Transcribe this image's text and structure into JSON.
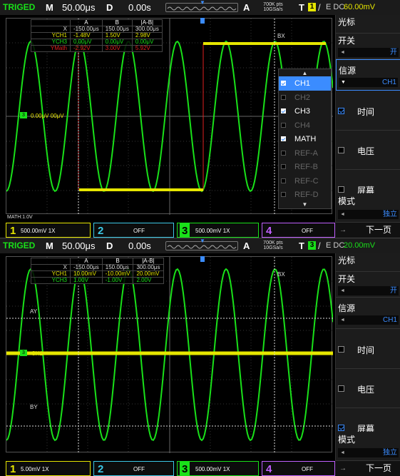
{
  "screens": [
    {
      "id": "s1",
      "top": {
        "status": "TRIGED",
        "m_label": "M",
        "timebase": "50.00μs",
        "d_label": "D",
        "delay": "0.00s",
        "acq": "A",
        "pts_top": "700K pts",
        "pts_bot": "10GSa/s",
        "t_label": "T",
        "trig_ch": "1",
        "edge": "/",
        "coupling": "E DC",
        "level": "60.00mV",
        "level_color": "#e6e600"
      },
      "meas": {
        "h_a": "A",
        "h_b": "B",
        "h_d": "|A-B|",
        "rows": [
          {
            "label": "X",
            "a": "-150.00μs",
            "b": "150.00μs",
            "d": "300.00μs",
            "color": "#dddddd"
          },
          {
            "label": "YCH1",
            "a": "-1.48V",
            "b": "1.50V",
            "d": "2.98V",
            "color": "#e6e600"
          },
          {
            "label": "YCH3",
            "a": "0.00μV",
            "b": "0.00μV",
            "d": "0.00μV",
            "color": "#19e019"
          },
          {
            "label": "YMath",
            "a": "-2.92V",
            "b": "3.00V",
            "d": "5.92V",
            "color": "#e02020"
          }
        ]
      },
      "labels": {
        "bx": "BX",
        "math_scale": "MATH:1.0V",
        "gnd_text": "0.00μV  00μV"
      },
      "side": {
        "title": "光标",
        "switch": "开关",
        "switch_val": "开",
        "source": "信源",
        "source_val": "CH1",
        "time": "时间",
        "time_on": true,
        "voltage": "电压",
        "voltage_on": false,
        "screen": "屏幕",
        "screen_on": false,
        "mode": "模式",
        "mode_val": "独立",
        "next": "下一页"
      },
      "channels": [
        {
          "n": "1",
          "v": "500.00mV  1X",
          "color": "#e6e600"
        },
        {
          "n": "2",
          "v": "OFF",
          "color": "#3cc8e6"
        },
        {
          "n": "3",
          "v": "500.00mV  1X",
          "color": "#19e019"
        },
        {
          "n": "4",
          "v": "OFF",
          "color": "#c060ff"
        }
      ],
      "dropdown": [
        {
          "l": "CH1",
          "on": true,
          "sel": true,
          "dis": false
        },
        {
          "l": "CH2",
          "on": false,
          "sel": false,
          "dis": true
        },
        {
          "l": "CH3",
          "on": true,
          "sel": false,
          "dis": false
        },
        {
          "l": "CH4",
          "on": false,
          "sel": false,
          "dis": true
        },
        {
          "l": "MATH",
          "on": true,
          "sel": false,
          "dis": false
        },
        {
          "l": "REF-A",
          "on": false,
          "sel": false,
          "dis": true
        },
        {
          "l": "REF-B",
          "on": false,
          "sel": false,
          "dis": true
        },
        {
          "l": "REF-C",
          "on": false,
          "sel": false,
          "dis": true
        },
        {
          "l": "REF-D",
          "on": false,
          "sel": false,
          "dis": true
        }
      ]
    },
    {
      "id": "s2",
      "top": {
        "status": "TRIGED",
        "m_label": "M",
        "timebase": "50.00μs",
        "d_label": "D",
        "delay": "0.00s",
        "acq": "A",
        "pts_top": "700K pts",
        "pts_bot": "10GSa/s",
        "t_label": "T",
        "trig_ch": "3",
        "edge": "/",
        "coupling": "E DC",
        "level": "20.00mV",
        "level_color": "#19e019"
      },
      "meas": {
        "h_a": "A",
        "h_b": "B",
        "h_d": "|A-B|",
        "rows": [
          {
            "label": "X",
            "a": "-150.00μs",
            "b": "150.00μs",
            "d": "300.00μs",
            "color": "#dddddd"
          },
          {
            "label": "YCH1",
            "a": "10.00mV",
            "b": "-10.00mV",
            "d": "20.00mV",
            "color": "#e6e600"
          },
          {
            "label": "YCH3",
            "a": "1.00V",
            "b": "-1.00V",
            "d": "2.00V",
            "color": "#19e019"
          }
        ]
      },
      "labels": {
        "bx": "BX",
        "ay": "AY",
        "by": "BY",
        "ch1": "CH1"
      },
      "side": {
        "title": "光标",
        "switch": "开关",
        "switch_val": "开",
        "source": "信源",
        "source_val": "CH1",
        "time": "时间",
        "time_on": false,
        "voltage": "电压",
        "voltage_on": false,
        "screen": "屏幕",
        "screen_on": true,
        "mode": "模式",
        "mode_val": "独立",
        "next": "下一页"
      },
      "channels": [
        {
          "n": "1",
          "v": "5.00mV  1X",
          "color": "#e6e600"
        },
        {
          "n": "2",
          "v": "OFF",
          "color": "#3cc8e6"
        },
        {
          "n": "3",
          "v": "500.00mV  1X",
          "color": "#19e019"
        },
        {
          "n": "4",
          "v": "OFF",
          "color": "#c060ff"
        }
      ]
    }
  ]
}
